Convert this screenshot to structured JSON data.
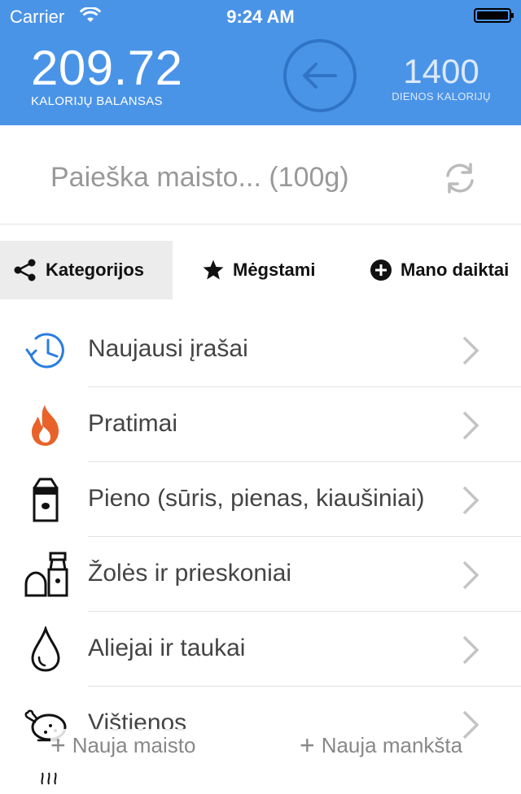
{
  "status_bar": {
    "carrier": "Carrier",
    "time": "9:24 AM"
  },
  "header": {
    "balance_value": "209.72",
    "balance_label": "KALORIJŲ BALANSAS",
    "daily_value": "1400",
    "daily_label": "DIENOS KALORIJŲ",
    "accent_color": "#4a94e8"
  },
  "search": {
    "placeholder": "Paieška maisto... (100g)"
  },
  "tabs": [
    {
      "label": "Kategorijos",
      "icon": "share-icon",
      "active": true
    },
    {
      "label": "Mėgstami",
      "icon": "star-icon",
      "active": false
    },
    {
      "label": "Mano daiktai",
      "icon": "plus-circle-icon",
      "active": false
    }
  ],
  "categories": [
    {
      "label": "Naujausi įrašai",
      "icon": "clock-history-icon"
    },
    {
      "label": "Pratimai",
      "icon": "flame-icon"
    },
    {
      "label": "Pieno (sūris, pienas, kiaušiniai)",
      "icon": "milk-carton-icon"
    },
    {
      "label": "Žolės ir prieskoniai",
      "icon": "salt-pepper-icon"
    },
    {
      "label": "Aliejai ir taukai",
      "icon": "oil-drop-icon"
    },
    {
      "label": "Vištienos",
      "icon": "chicken-icon"
    }
  ],
  "bottom_actions": {
    "new_food": "Nauja maisto",
    "new_exercise": "Nauja mankšta"
  }
}
